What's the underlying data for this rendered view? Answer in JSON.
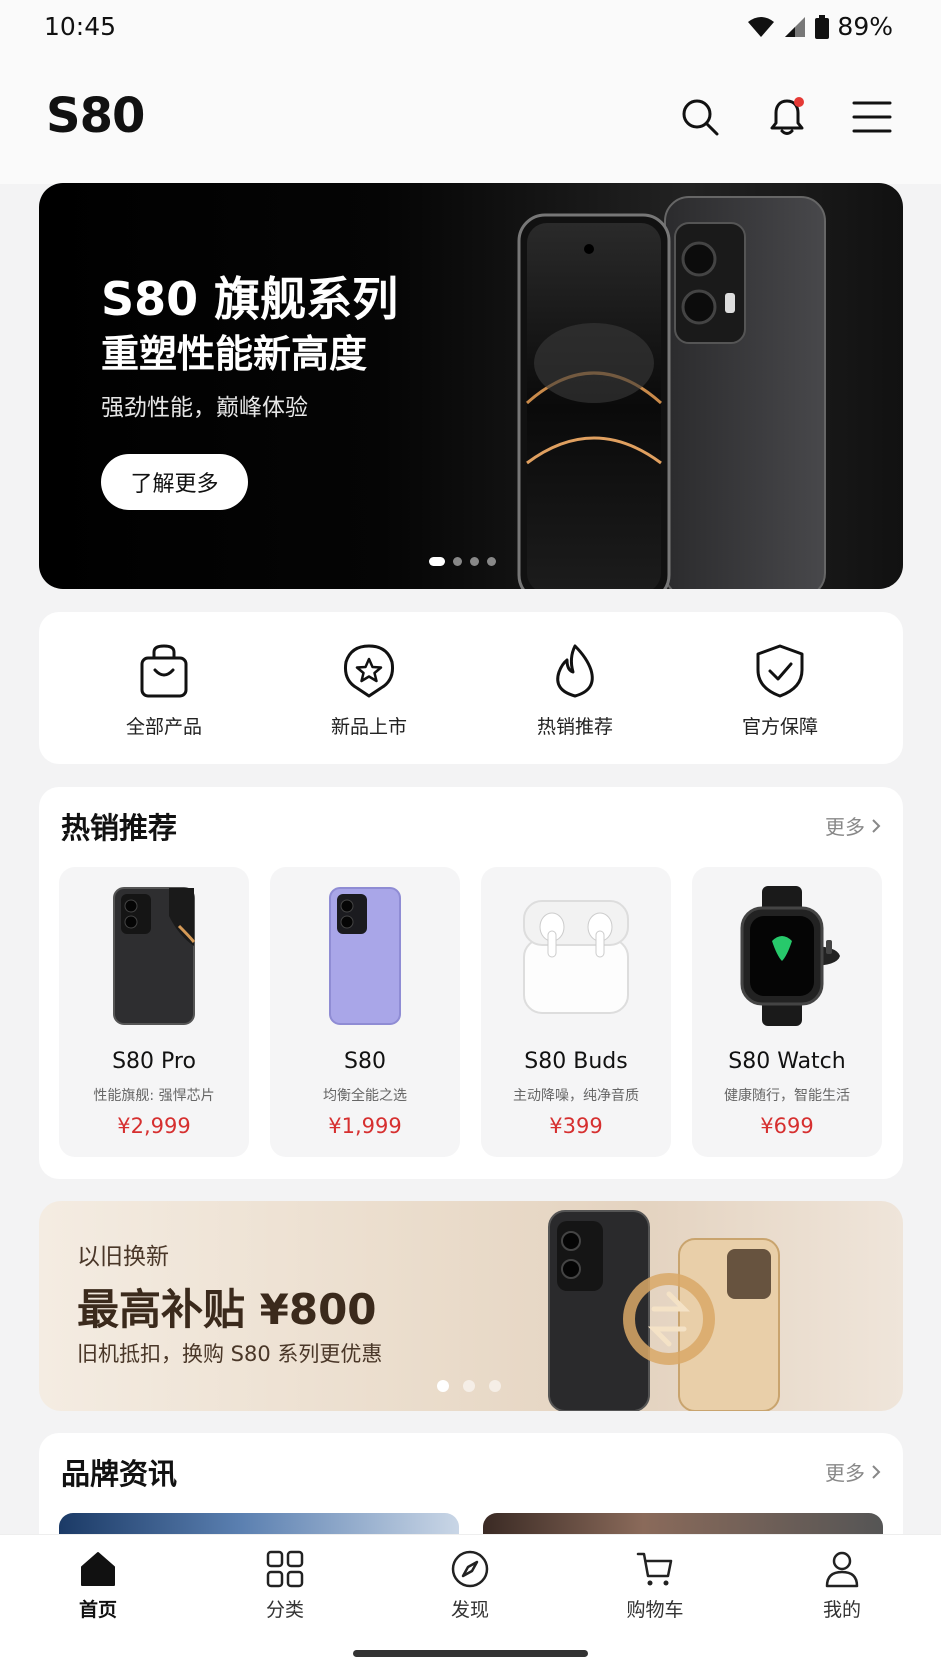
{
  "status": {
    "time": "10:45",
    "battery": "89%"
  },
  "header": {
    "title": "S80"
  },
  "hero": {
    "title": "S80 旗舰系列",
    "subtitle": "重塑性能新高度",
    "desc": "强劲性能，巅峰体验",
    "button": "了解更多",
    "slide_count": 4,
    "active_slide": 1
  },
  "quick": [
    {
      "label": "全部产品",
      "icon": "shopping-bag-icon"
    },
    {
      "label": "新品上市",
      "icon": "star-badge-icon"
    },
    {
      "label": "热销推荐",
      "icon": "flame-icon"
    },
    {
      "label": "官方保障",
      "icon": "shield-check-icon"
    }
  ],
  "hot": {
    "title": "热销推荐",
    "more": "更多",
    "items": [
      {
        "name": "S80 Pro",
        "desc": "性能旗舰: 强悍芯片",
        "price": "¥2,999",
        "image": "black-phone"
      },
      {
        "name": "S80",
        "desc": "均衡全能之选",
        "price": "¥1,999",
        "image": "lavender-phone"
      },
      {
        "name": "S80 Buds",
        "desc": "主动降噪，纯净音质",
        "price": "¥399",
        "image": "earbuds"
      },
      {
        "name": "S80 Watch",
        "desc": "健康随行，智能生活",
        "price": "¥699",
        "image": "smartwatch"
      }
    ]
  },
  "promo": {
    "tag": "以旧换新",
    "title": "最高补贴 ¥800",
    "desc": "旧机抵扣，换购 S80 系列更优惠",
    "slide_count": 3,
    "active_slide": 1
  },
  "news": {
    "title": "品牌资讯",
    "more": "更多"
  },
  "tabs": [
    {
      "label": "首页",
      "icon": "home-icon",
      "active": true
    },
    {
      "label": "分类",
      "icon": "grid-icon",
      "active": false
    },
    {
      "label": "发现",
      "icon": "compass-icon",
      "active": false
    },
    {
      "label": "购物车",
      "icon": "cart-icon",
      "active": false
    },
    {
      "label": "我的",
      "icon": "user-icon",
      "active": false
    }
  ],
  "colors": {
    "price": "#d62f2f",
    "accent_dot": "#e53935",
    "promo_text": "#3b2a1c"
  }
}
